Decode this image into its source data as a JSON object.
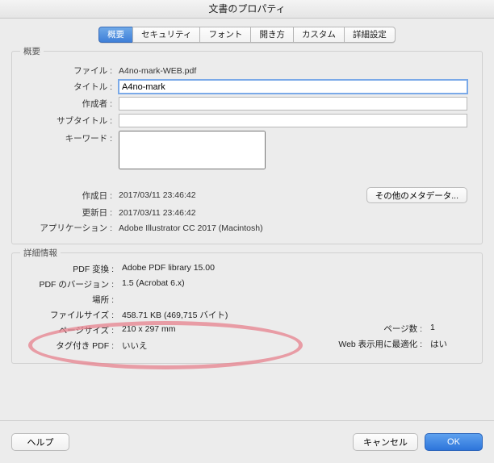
{
  "window": {
    "title": "文書のプロパティ"
  },
  "tabs": {
    "items": [
      "概要",
      "セキュリティ",
      "フォント",
      "開き方",
      "カスタム",
      "詳細設定"
    ],
    "active_index": 0
  },
  "summary": {
    "group_title": "概要",
    "labels": {
      "file": "ファイル :",
      "title": "タイトル :",
      "author": "作成者 :",
      "subtitle": "サブタイトル :",
      "keywords": "キーワード :",
      "created": "作成日 :",
      "updated": "更新日 :",
      "app": "アプリケーション :"
    },
    "values": {
      "file": "A4no-mark-WEB.pdf",
      "title": "A4no-mark",
      "author": "",
      "subtitle": "",
      "keywords": "",
      "created": "2017/03/11 23:46:42",
      "updated": "2017/03/11 23:46:42",
      "app": "Adobe Illustrator CC 2017 (Macintosh)"
    },
    "other_metadata_btn": "その他のメタデータ..."
  },
  "details": {
    "group_title": "詳細情報",
    "labels": {
      "pdf_conv": "PDF 変換 :",
      "pdf_ver": "PDF のバージョン :",
      "location": "場所 :",
      "filesize": "ファイルサイズ :",
      "pagesize": "ページサイズ :",
      "tagged": "タグ付き PDF :",
      "pagecount": "ページ数 :",
      "fastweb": "Web 表示用に最適化 :"
    },
    "values": {
      "pdf_conv": "Adobe PDF library 15.00",
      "pdf_ver": "1.5 (Acrobat 6.x)",
      "location": "",
      "filesize": "458.71 KB (469,715 バイト)",
      "pagesize": "210 x 297 mm",
      "tagged": "いいえ",
      "pagecount": "1",
      "fastweb": "はい"
    }
  },
  "footer": {
    "help": "ヘルプ",
    "cancel": "キャンセル",
    "ok": "OK"
  }
}
